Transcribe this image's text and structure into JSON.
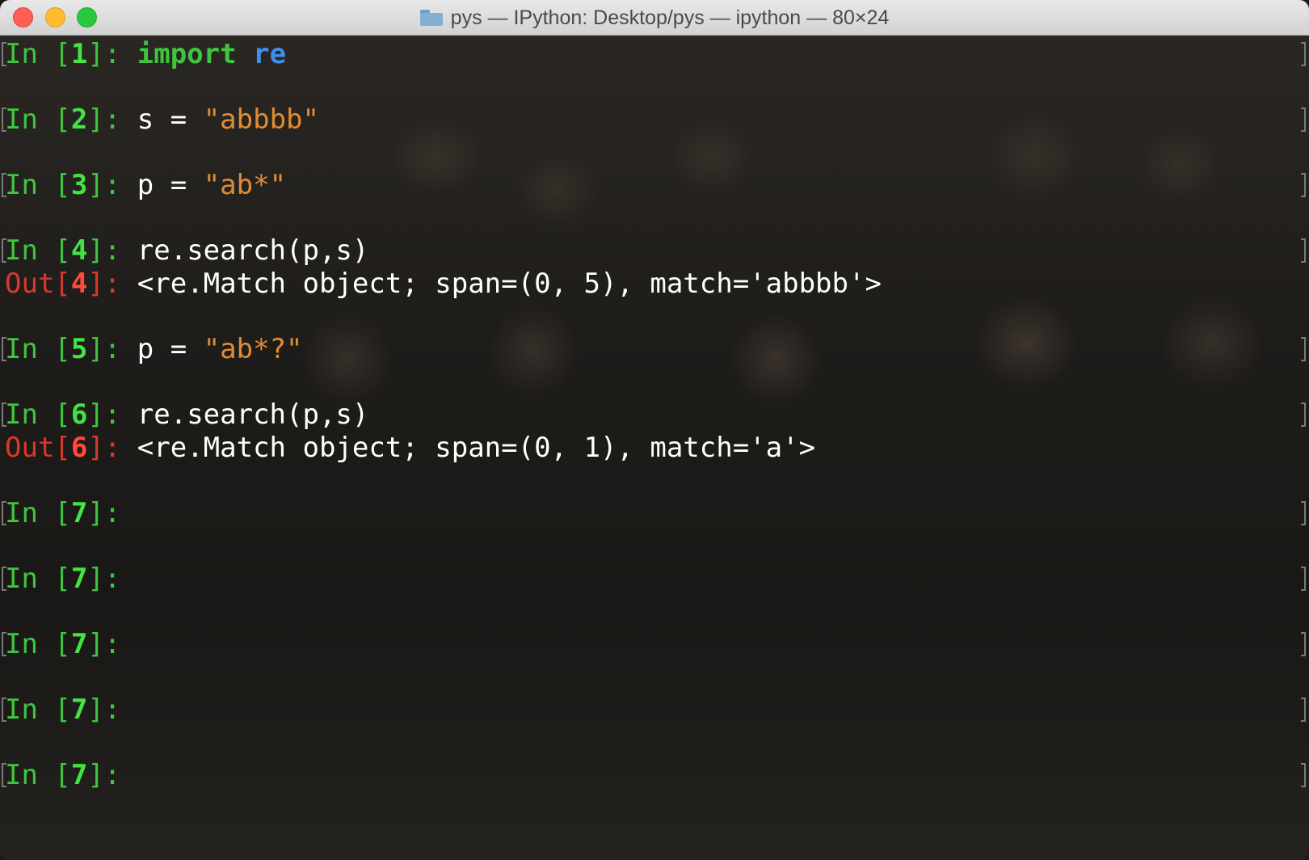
{
  "window": {
    "title": "pys — IPython: Desktop/pys — ipython — 80×24",
    "icon": "folder-icon"
  },
  "terminal": {
    "lines": [
      {
        "kind": "in",
        "prefix": "In [",
        "num": "1",
        "suffix": "]: ",
        "parts": [
          {
            "text": "import",
            "style": "kw"
          },
          {
            "text": " ",
            "style": "code"
          },
          {
            "text": "re",
            "style": "mod"
          }
        ]
      },
      {
        "kind": "in",
        "prefix": "In [",
        "num": "2",
        "suffix": "]: ",
        "parts": [
          {
            "text": "s = ",
            "style": "code"
          },
          {
            "text": "\"abbbb\"",
            "style": "str"
          }
        ]
      },
      {
        "kind": "in",
        "prefix": "In [",
        "num": "3",
        "suffix": "]: ",
        "parts": [
          {
            "text": "p = ",
            "style": "code"
          },
          {
            "text": "\"ab*\"",
            "style": "str"
          }
        ]
      },
      {
        "kind": "in",
        "prefix": "In [",
        "num": "4",
        "suffix": "]: ",
        "parts": [
          {
            "text": "re.search(p,s)",
            "style": "code"
          }
        ]
      },
      {
        "kind": "out",
        "prefix": "Out[",
        "num": "4",
        "suffix": "]: ",
        "parts": [
          {
            "text": "<re.Match object; span=(0, 5), match='abbbb'>",
            "style": "code"
          }
        ]
      },
      {
        "kind": "in",
        "prefix": "In [",
        "num": "5",
        "suffix": "]: ",
        "parts": [
          {
            "text": "p = ",
            "style": "code"
          },
          {
            "text": "\"ab*?\"",
            "style": "str"
          }
        ]
      },
      {
        "kind": "in",
        "prefix": "In [",
        "num": "6",
        "suffix": "]: ",
        "parts": [
          {
            "text": "re.search(p,s)",
            "style": "code"
          }
        ]
      },
      {
        "kind": "out",
        "prefix": "Out[",
        "num": "6",
        "suffix": "]: ",
        "parts": [
          {
            "text": "<re.Match object; span=(0, 1), match='a'>",
            "style": "code"
          }
        ]
      },
      {
        "kind": "in",
        "prefix": "In [",
        "num": "7",
        "suffix": "]: ",
        "parts": []
      },
      {
        "kind": "in",
        "prefix": "In [",
        "num": "7",
        "suffix": "]: ",
        "parts": []
      },
      {
        "kind": "in",
        "prefix": "In [",
        "num": "7",
        "suffix": "]: ",
        "parts": []
      },
      {
        "kind": "in",
        "prefix": "In [",
        "num": "7",
        "suffix": "]: ",
        "parts": []
      },
      {
        "kind": "in",
        "prefix": "In [",
        "num": "7",
        "suffix": "]: ",
        "parts": []
      }
    ]
  },
  "colors": {
    "prompt_in": "#3fc53f",
    "prompt_out": "#d9382f",
    "string": "#e08c34",
    "module": "#3f8fe8"
  }
}
